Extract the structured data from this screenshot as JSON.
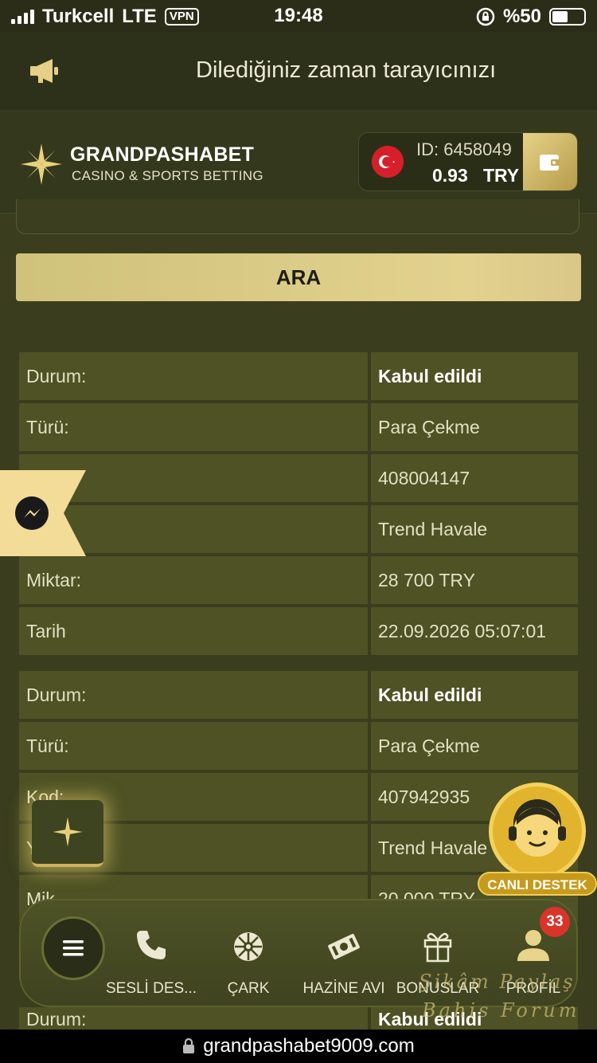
{
  "status_bar": {
    "carrier": "Turkcell",
    "network": "LTE",
    "vpn": "VPN",
    "time": "19:48",
    "battery_text": "%50",
    "battery_level": 0.5
  },
  "announcement": {
    "text": "Dilediğiniz zaman tarayıcınızı",
    "icon": "megaphone-icon"
  },
  "header": {
    "brand": "GRANDPASHABET",
    "tagline": "CASINO & SPORTS BETTING",
    "account_id": "ID: 6458049",
    "balance": "0.93",
    "currency": "TRY",
    "flag": "turkey-flag-icon",
    "wallet_icon": "wallet-icon"
  },
  "search_button": "ARA",
  "records": [
    {
      "rows": [
        {
          "key": "Durum:",
          "value": "Kabul edildi",
          "strong": true
        },
        {
          "key": "Türü:",
          "value": "Para Çekme"
        },
        {
          "key": "",
          "value": "408004147"
        },
        {
          "key": "em:",
          "value": "Trend Havale"
        },
        {
          "key": "Miktar:",
          "value": "28 700 TRY"
        },
        {
          "key": "Tarih",
          "value": "22.09.2026 05:07:01"
        }
      ]
    },
    {
      "rows": [
        {
          "key": "Durum:",
          "value": "Kabul edildi",
          "strong": true
        },
        {
          "key": "Türü:",
          "value": "Para Çekme"
        },
        {
          "key": "Kod:",
          "value": "407942935"
        },
        {
          "key": "Y",
          "value": "Trend Havale"
        },
        {
          "key": "Mik",
          "value": "20 000 TRY"
        }
      ]
    }
  ],
  "partial_record": {
    "key": "Durum:",
    "value": "Kabul edildi"
  },
  "live_support": "CANLI DESTEK",
  "bottom_nav": {
    "items": [
      {
        "label": "SESLİ DES...",
        "icon": "phone-icon"
      },
      {
        "label": "ÇARK",
        "icon": "wheel-icon"
      },
      {
        "label": "HAZİNE AVI",
        "icon": "money-icon"
      },
      {
        "label": "BONUSLAR",
        "icon": "gift-icon"
      },
      {
        "label": "PROFİL",
        "icon": "user-icon"
      }
    ],
    "profile_badge": "33"
  },
  "watermark": {
    "line1": "Şikâm Paylaş",
    "line2": "Bahis Forum"
  },
  "url": "grandpashabet9009.com",
  "colors": {
    "accent_gold": "#d8c884",
    "background": "#3a3e1e",
    "cell": "#4e5224",
    "badge_red": "#d9342a"
  }
}
